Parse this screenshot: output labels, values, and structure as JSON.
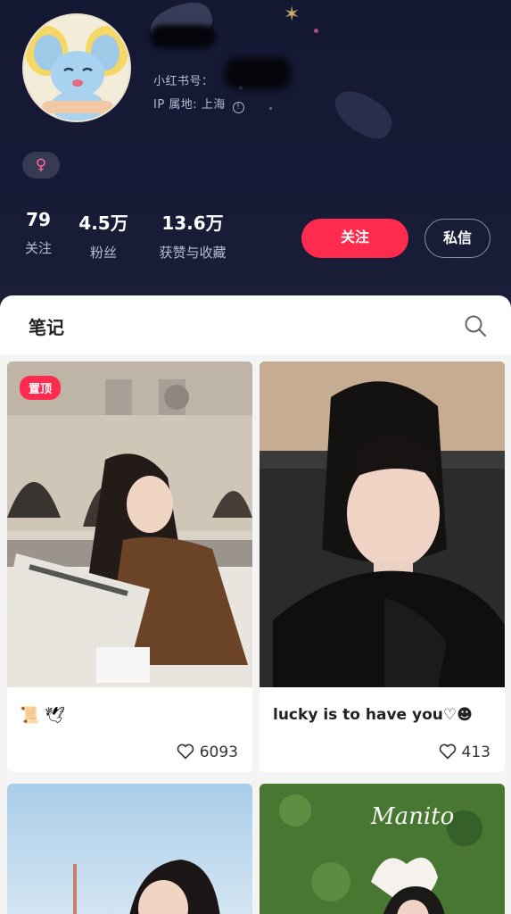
{
  "profile": {
    "id_label": "小红书号：",
    "ip_label": "IP 属地: 上海",
    "info_symbol": "!",
    "gender_symbol": "♀"
  },
  "stats": [
    {
      "value": "79",
      "label": "关注"
    },
    {
      "value": "4.5万",
      "label": "粉丝"
    },
    {
      "value": "13.6万",
      "label": "获赞与收藏"
    }
  ],
  "actions": {
    "follow": "关注",
    "message": "私信"
  },
  "tabs": {
    "notes": "笔记"
  },
  "notes": [
    {
      "pinned_label": "置顶",
      "title_icons": "📜 🕊",
      "likes": "6093"
    },
    {
      "title": "lucky is to have you♡☻",
      "likes": "413"
    },
    {},
    {
      "overlay_text": "Manito"
    }
  ],
  "colors": {
    "accent": "#ff2b4e",
    "header_bg": "#161a36"
  }
}
